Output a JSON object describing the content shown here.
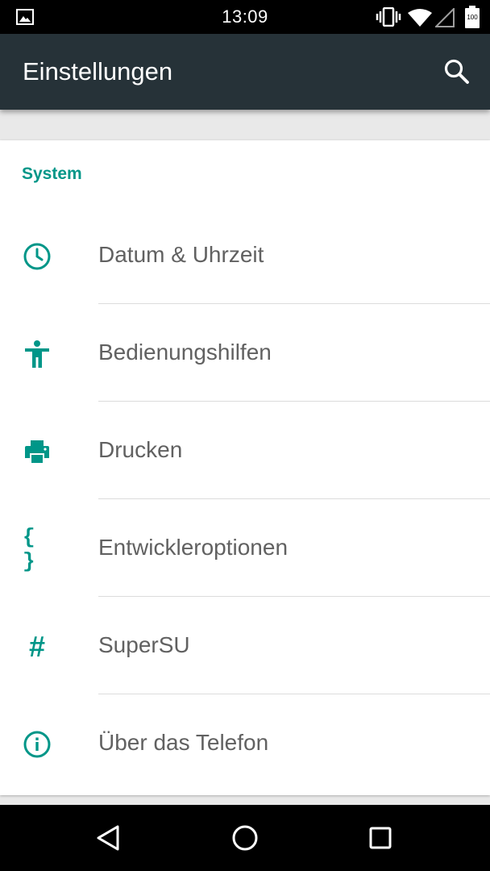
{
  "status_bar": {
    "time": "13:09",
    "battery": "100",
    "icons": [
      "image-notification-icon",
      "vibrate-icon",
      "wifi-icon",
      "signal-icon",
      "battery-icon"
    ]
  },
  "app_bar": {
    "title": "Einstellungen",
    "search_icon": "search-icon"
  },
  "section": {
    "header": "System",
    "items": [
      {
        "label": "Datum & Uhrzeit",
        "icon": "clock-icon"
      },
      {
        "label": "Bedienungshilfen",
        "icon": "accessibility-icon"
      },
      {
        "label": "Drucken",
        "icon": "printer-icon"
      },
      {
        "label": "Entwickleroptionen",
        "icon": "braces-icon",
        "glyph": "{ }"
      },
      {
        "label": "SuperSU",
        "icon": "hash-icon",
        "glyph": "#"
      },
      {
        "label": "Über das Telefon",
        "icon": "info-icon"
      }
    ]
  },
  "nav_bar": {
    "buttons": [
      "back-icon",
      "home-icon",
      "recents-icon"
    ]
  },
  "colors": {
    "accent": "#009688",
    "app_bar": "#263238",
    "text_secondary": "#616161"
  }
}
